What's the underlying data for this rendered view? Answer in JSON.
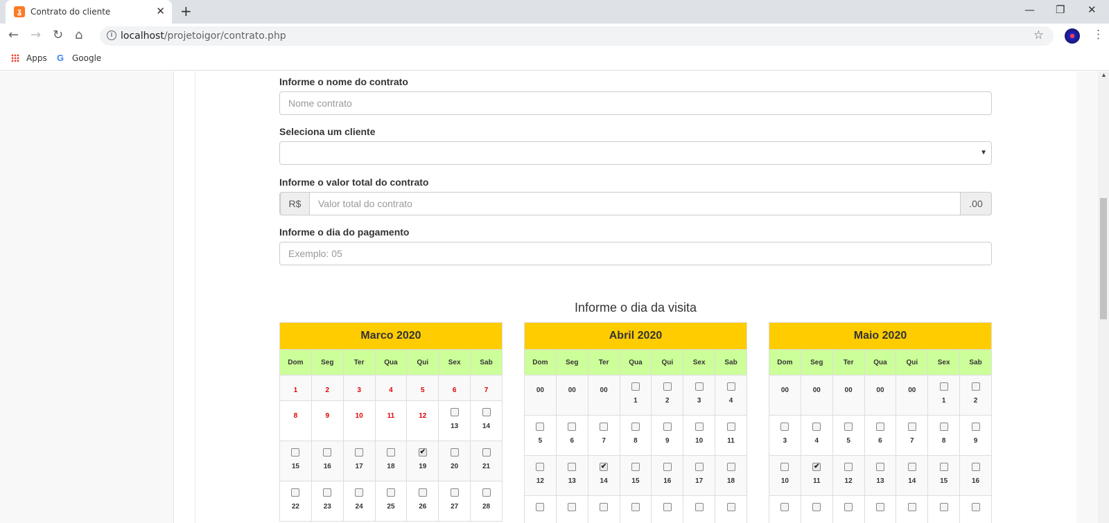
{
  "browser": {
    "tab_title": "Contrato do cliente",
    "tab_favicon": "xampp-icon",
    "url_host": "localhost",
    "url_path": "/projetoigor/contrato.php",
    "bookmarks": {
      "apps": "Apps",
      "google": "Google"
    }
  },
  "form": {
    "nome_label": "Informe o nome do contrato",
    "nome_placeholder": "Nome contrato",
    "cliente_label": "Seleciona um cliente",
    "cliente_value": "",
    "valor_label": "Informe o valor total do contrato",
    "valor_prefix": "R$",
    "valor_placeholder": "Valor total do contrato",
    "valor_suffix": ".00",
    "dia_label": "Informe o dia do pagamento",
    "dia_placeholder": "Exemplo: 05"
  },
  "visita_title": "Informe o dia da visita",
  "weekdays": [
    "Dom",
    "Seg",
    "Ter",
    "Qua",
    "Qui",
    "Sex",
    "Sab"
  ],
  "calendars": [
    {
      "month": "Marco 2020",
      "weeks": [
        [
          {
            "d": "1",
            "t": "red"
          },
          {
            "d": "2",
            "t": "red"
          },
          {
            "d": "3",
            "t": "red"
          },
          {
            "d": "4",
            "t": "red"
          },
          {
            "d": "5",
            "t": "red"
          },
          {
            "d": "6",
            "t": "red"
          },
          {
            "d": "7",
            "t": "red"
          }
        ],
        [
          {
            "d": "8",
            "t": "red"
          },
          {
            "d": "9",
            "t": "red"
          },
          {
            "d": "10",
            "t": "red"
          },
          {
            "d": "11",
            "t": "red"
          },
          {
            "d": "12",
            "t": "red"
          },
          {
            "d": "13",
            "t": "cb"
          },
          {
            "d": "14",
            "t": "cb"
          }
        ],
        [
          {
            "d": "15",
            "t": "cb"
          },
          {
            "d": "16",
            "t": "cb"
          },
          {
            "d": "17",
            "t": "cb"
          },
          {
            "d": "18",
            "t": "cb"
          },
          {
            "d": "19",
            "t": "cb",
            "checked": true
          },
          {
            "d": "20",
            "t": "cb"
          },
          {
            "d": "21",
            "t": "cb"
          }
        ],
        [
          {
            "d": "22",
            "t": "cb"
          },
          {
            "d": "23",
            "t": "cb"
          },
          {
            "d": "24",
            "t": "cb"
          },
          {
            "d": "25",
            "t": "cb"
          },
          {
            "d": "26",
            "t": "cb"
          },
          {
            "d": "27",
            "t": "cb"
          },
          {
            "d": "28",
            "t": "cb"
          }
        ]
      ]
    },
    {
      "month": "Abril 2020",
      "weeks": [
        [
          {
            "d": "00",
            "t": "gray"
          },
          {
            "d": "00",
            "t": "gray"
          },
          {
            "d": "00",
            "t": "gray"
          },
          {
            "d": "1",
            "t": "cb"
          },
          {
            "d": "2",
            "t": "cb"
          },
          {
            "d": "3",
            "t": "cb"
          },
          {
            "d": "4",
            "t": "cb"
          }
        ],
        [
          {
            "d": "5",
            "t": "cb"
          },
          {
            "d": "6",
            "t": "cb"
          },
          {
            "d": "7",
            "t": "cb"
          },
          {
            "d": "8",
            "t": "cb"
          },
          {
            "d": "9",
            "t": "cb"
          },
          {
            "d": "10",
            "t": "cb"
          },
          {
            "d": "11",
            "t": "cb"
          }
        ],
        [
          {
            "d": "12",
            "t": "cb"
          },
          {
            "d": "13",
            "t": "cb"
          },
          {
            "d": "14",
            "t": "cb",
            "checked": true
          },
          {
            "d": "15",
            "t": "cb"
          },
          {
            "d": "16",
            "t": "cb"
          },
          {
            "d": "17",
            "t": "cb"
          },
          {
            "d": "18",
            "t": "cb"
          }
        ],
        [
          {
            "d": "",
            "t": "cb"
          },
          {
            "d": "",
            "t": "cb"
          },
          {
            "d": "",
            "t": "cb"
          },
          {
            "d": "",
            "t": "cb"
          },
          {
            "d": "",
            "t": "cb"
          },
          {
            "d": "",
            "t": "cb"
          },
          {
            "d": "",
            "t": "cb"
          }
        ]
      ]
    },
    {
      "month": "Maio 2020",
      "weeks": [
        [
          {
            "d": "00",
            "t": "gray"
          },
          {
            "d": "00",
            "t": "gray"
          },
          {
            "d": "00",
            "t": "gray"
          },
          {
            "d": "00",
            "t": "gray"
          },
          {
            "d": "00",
            "t": "gray"
          },
          {
            "d": "1",
            "t": "cb"
          },
          {
            "d": "2",
            "t": "cb"
          }
        ],
        [
          {
            "d": "3",
            "t": "cb"
          },
          {
            "d": "4",
            "t": "cb"
          },
          {
            "d": "5",
            "t": "cb"
          },
          {
            "d": "6",
            "t": "cb"
          },
          {
            "d": "7",
            "t": "cb"
          },
          {
            "d": "8",
            "t": "cb"
          },
          {
            "d": "9",
            "t": "cb"
          }
        ],
        [
          {
            "d": "10",
            "t": "cb"
          },
          {
            "d": "11",
            "t": "cb",
            "checked": true
          },
          {
            "d": "12",
            "t": "cb"
          },
          {
            "d": "13",
            "t": "cb"
          },
          {
            "d": "14",
            "t": "cb"
          },
          {
            "d": "15",
            "t": "cb"
          },
          {
            "d": "16",
            "t": "cb"
          }
        ],
        [
          {
            "d": "",
            "t": "cb"
          },
          {
            "d": "",
            "t": "cb"
          },
          {
            "d": "",
            "t": "cb"
          },
          {
            "d": "",
            "t": "cb"
          },
          {
            "d": "",
            "t": "cb"
          },
          {
            "d": "",
            "t": "cb"
          },
          {
            "d": "",
            "t": "cb"
          }
        ]
      ]
    }
  ]
}
